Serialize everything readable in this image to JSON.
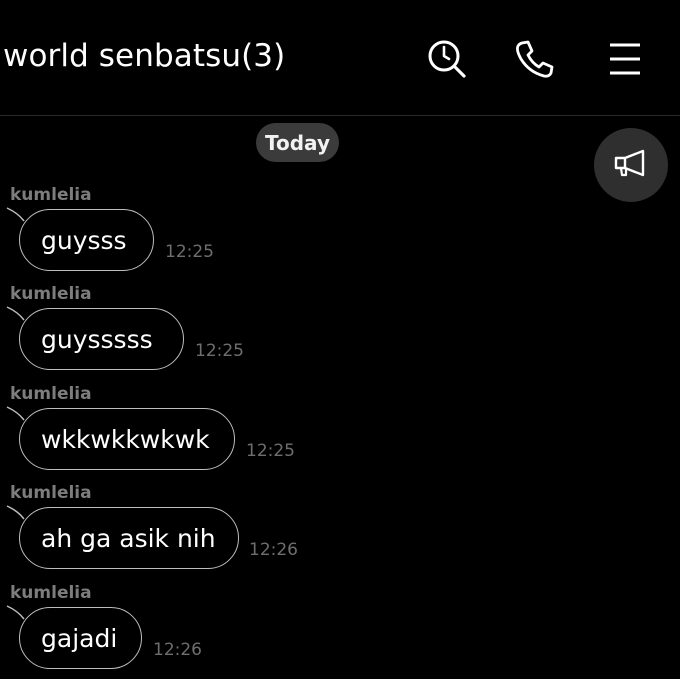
{
  "header": {
    "title": "world senbatsu(3)",
    "icons": [
      "search-icon",
      "phone-icon",
      "menu-icon"
    ]
  },
  "chat": {
    "date_divider": "Today",
    "announcement_icon": "megaphone-icon",
    "messages": [
      {
        "sender": "kumlelia",
        "text": "guysss",
        "time": "12:25"
      },
      {
        "sender": "kumlelia",
        "text": "guysssss",
        "time": "12:25"
      },
      {
        "sender": "kumlelia",
        "text": "wkkwkkwkwk",
        "time": "12:25"
      },
      {
        "sender": "kumlelia",
        "text": "ah ga asik nih",
        "time": "12:26"
      },
      {
        "sender": "kumlelia",
        "text": "gajadi",
        "time": "12:26"
      }
    ]
  },
  "colors": {
    "background": "#000000",
    "bubble_border": "#bdbdbd",
    "sender": "#7d7d7d",
    "timestamp": "#6e6e6e",
    "date_pill": "#3b3b3b"
  }
}
